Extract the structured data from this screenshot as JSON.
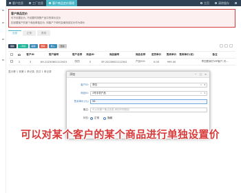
{
  "topbar": {
    "tabs": [
      {
        "label": "客户信息",
        "active": false,
        "icon": "user-icon"
      },
      {
        "label": "工厂信息",
        "active": false,
        "icon": "factory-icon"
      },
      {
        "label": "客户商品定价管理",
        "active": true,
        "icon": "tag-icon"
      }
    ],
    "right": [
      {
        "label": "主页",
        "icon": "home-icon"
      },
      {
        "label": "清除缓存",
        "icon": "trash-icon"
      },
      {
        "label": "",
        "icon": "user-icon"
      }
    ]
  },
  "notice": {
    "title": "客户商品定价",
    "lines": [
      "可不设置定价, 不设置时按照产品中的单价定价",
      "如设置客户的某个商品单独定价, 则客户下单时会使用该定价作为单价"
    ]
  },
  "subtabs": [
    {
      "label": "全部",
      "active": true
    },
    {
      "label": "正常",
      "active": false
    },
    {
      "label": "禁用",
      "active": false
    }
  ],
  "toolbar": {
    "refresh": "刷新",
    "add": "+添加",
    "edit": "编辑",
    "delete": "删除",
    "import": "导入",
    "more": "更多"
  },
  "table": {
    "headers": [
      "ID",
      "客户ID",
      "客户编号",
      "客户名称",
      "商品ID",
      "商品编号",
      "商品名称",
      "售卖单价",
      "",
      "",
      "备注"
    ],
    "rows": [
      {
        "id": "2",
        "customer_id": "3",
        "customer_no": "KH-20230601112615",
        "customer_name": "张四",
        "product_id": "5",
        "product_no": "SP-20230601112541",
        "product_name": "产品001",
        "price1": "0.00",
        "price2": "999.00",
        "note": "李四是我们VIP客户,可..."
      }
    ],
    "header_extra": [
      "进货单价",
      "售卖单价(优)"
    ],
    "footer": "显示第 1 到第 1 条记录, 总共 1 条记录"
  },
  "modal": {
    "title": "添加",
    "controls": [
      "−",
      "▢",
      "✕"
    ],
    "fields": {
      "customer_label": "客户ID:",
      "customer_value": "李四",
      "product_label": "商品ID:",
      "product_value": "4号手机产品",
      "price_label": "售卖单价(元):",
      "price_value": "98",
      "note_label": "备注:",
      "note_placeholder": "可以设置个备注信息,例如写明原因",
      "status_label": "状态:",
      "status_options": [
        "正常",
        "隐藏"
      ]
    }
  },
  "overlay_caption": "可以对某个客户的某个商品进行单独设置价"
}
